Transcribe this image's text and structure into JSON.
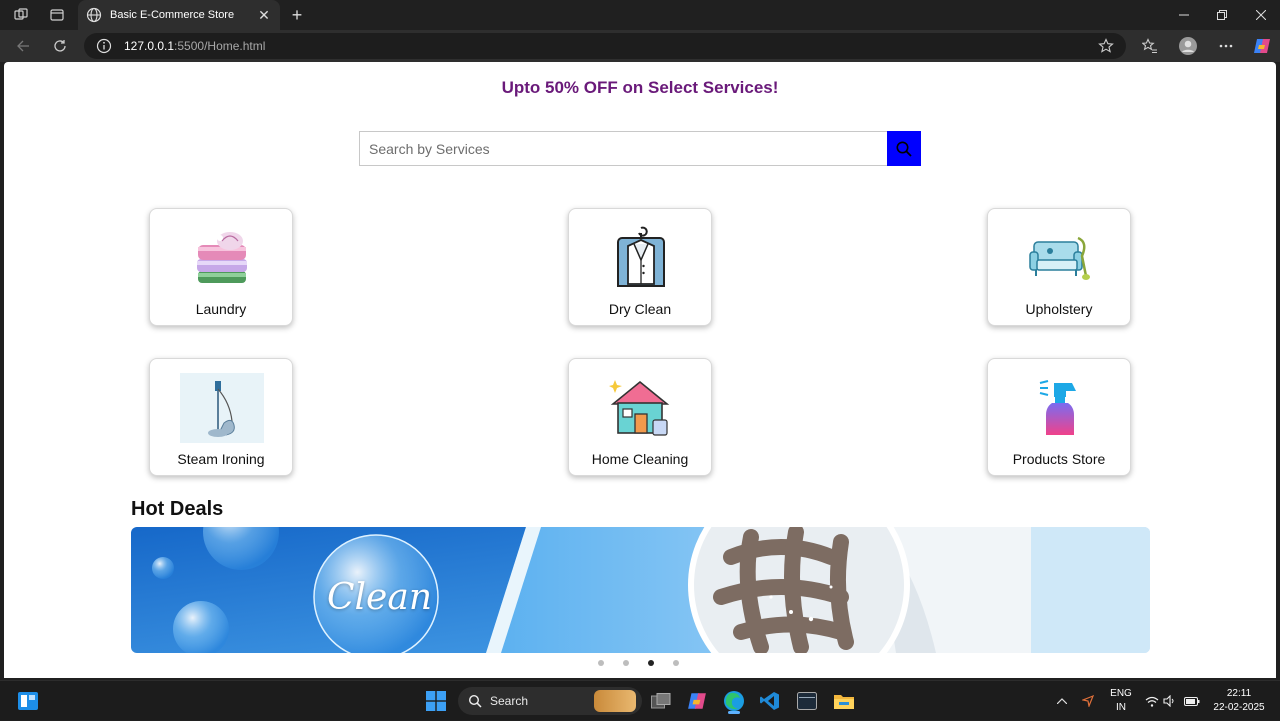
{
  "browser": {
    "tab_title": "Basic E-Commerce Store",
    "url_host": "127.0.0.1",
    "url_path": ":5500/Home.html"
  },
  "page": {
    "offer_text": "Upto 50% OFF on Select Services!",
    "search": {
      "placeholder": "Search by Services",
      "value": ""
    },
    "services": [
      {
        "label": "Laundry",
        "icon": "laundry-icon"
      },
      {
        "label": "Dry Clean",
        "icon": "dry-clean-icon"
      },
      {
        "label": "Upholstery",
        "icon": "upholstery-icon"
      },
      {
        "label": "Steam Ironing",
        "icon": "steam-ironing-icon"
      },
      {
        "label": "Home Cleaning",
        "icon": "home-cleaning-icon"
      },
      {
        "label": "Products Store",
        "icon": "products-store-icon"
      }
    ],
    "hot_deals_title": "Hot Deals",
    "banner_text": "Clean",
    "carousel": {
      "total": 4,
      "active_index": 2
    },
    "accent_color": "#0000ff",
    "offer_color": "#6a1a7a"
  },
  "taskbar": {
    "search_label": "Search",
    "lang_line1": "ENG",
    "lang_line2": "IN",
    "time": "22:11",
    "date": "22-02-2025"
  }
}
